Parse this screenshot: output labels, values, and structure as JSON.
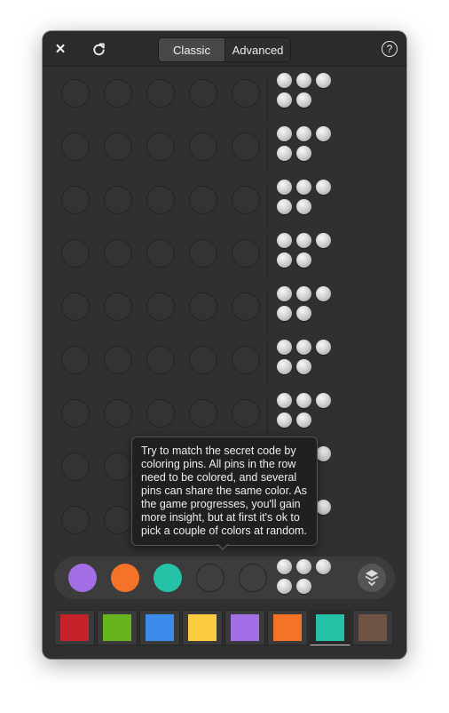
{
  "header": {
    "close_label": "×",
    "help_label": "?",
    "mode_tabs": [
      {
        "label": "Classic",
        "active": true
      },
      {
        "label": "Advanced",
        "active": false
      }
    ]
  },
  "board": {
    "rows": 9,
    "pins_per_row": 5,
    "hints_per_row": 5
  },
  "current_row": {
    "pins": [
      "#a36ee6",
      "#f57229",
      "#26c2a7",
      null,
      null
    ],
    "reveal_icon": "layers-down-icon"
  },
  "palette": {
    "colors": [
      "#c6222b",
      "#66b51f",
      "#3a8bea",
      "#fbcc3f",
      "#a36ee6",
      "#f57229",
      "#26c2a7",
      "#6f5446"
    ],
    "selected_index": 6
  },
  "tooltip": {
    "text": "Try to match the secret code by coloring pins. All pins in the row need to be colored, and several pins can share the same color. As the game progresses, you'll gain more insight, but at first it's ok to pick a couple of colors at random."
  },
  "colors": {
    "window_bg": "#303030",
    "hint_peg": "#d4d4d4"
  }
}
